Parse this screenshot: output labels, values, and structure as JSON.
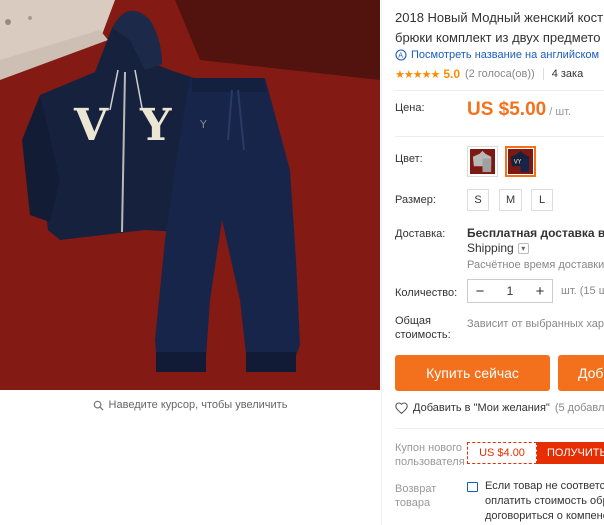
{
  "product": {
    "title_line1": "2018 Новый Модный женский кост",
    "title_line2": "брюки комплект из двух предмето",
    "translate_link": "Посмотреть название на английском",
    "rating_stars": "★★★★★",
    "rating_score": "5.0",
    "rating_votes": "(2 голоса(ов))",
    "orders": "4 зака"
  },
  "price": {
    "label": "Цена:",
    "value": "US $5.00",
    "unit": "/ шт."
  },
  "color": {
    "label": "Цвет:",
    "options": [
      "grey-suit",
      "navy-suit"
    ],
    "selected_index": 1
  },
  "size": {
    "label": "Размер:",
    "options": [
      "S",
      "M",
      "L"
    ]
  },
  "shipping": {
    "label": "Доставка:",
    "main": "Бесплатная доставка в Ru",
    "method": "Shipping",
    "time": "Расчётное время доставки:"
  },
  "quantity": {
    "label": "Количество:",
    "value": "1",
    "minus": "−",
    "plus": "+",
    "unit": "шт. (15 ш"
  },
  "total": {
    "label_line1": "Общая",
    "label_line2": "стоимость:",
    "value": "Зависит от выбранных хара"
  },
  "actions": {
    "buy_now": "Купить сейчас",
    "add_to_cart": "Доб"
  },
  "wishlist": {
    "label": "Добавить в \"Мои желания\"",
    "count": "(5 добавл"
  },
  "coupon": {
    "label_line1": "Купон нового",
    "label_line2": "пользователя",
    "amount": "US $4.00",
    "get": "ПОЛУЧИТЬ"
  },
  "returns": {
    "label_line1": "Возврат",
    "label_line2": "товара",
    "text_line1": "Если товар не соответст",
    "text_line2": "оплатить стоимость обра",
    "text_line3": "договориться о компенс"
  },
  "gallery": {
    "zoom_hint": "Наведите курсор, чтобы увеличить",
    "garment_letters": "VY"
  },
  "colors": {
    "accent": "#f3711d",
    "link": "#1a5dbf",
    "coupon": "#e62e04",
    "star": "#ff8a00"
  }
}
